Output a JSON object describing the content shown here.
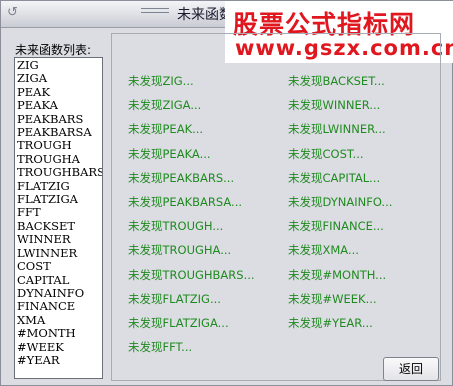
{
  "window": {
    "title": "未来函数",
    "watermark_line1": "股票公式指标网",
    "watermark_line2": "www.gszx.com.cn"
  },
  "list": {
    "label": "未来函数列表:",
    "items": [
      "ZIG",
      "ZIGA",
      "PEAK",
      "PEAKA",
      "PEAKBARS",
      "PEAKBARSA",
      "TROUGH",
      "TROUGHA",
      "TROUGHBARS",
      "FLATZIG",
      "FLATZIGA",
      "FFT",
      "BACKSET",
      "WINNER",
      "LWINNER",
      "COST",
      "CAPITAL",
      "DYNAINFO",
      "FINANCE",
      "XMA",
      "#MONTH",
      "#WEEK",
      "#YEAR"
    ]
  },
  "results": {
    "left": [
      "未发现ZIG...",
      "未发现ZIGA...",
      "未发现PEAK...",
      "未发现PEAKA...",
      "未发现PEAKBARS...",
      "未发现PEAKBARSA...",
      "未发现TROUGH...",
      "未发现TROUGHA...",
      "未发现TROUGHBARS...",
      "未发现FLATZIG...",
      "未发现FLATZIGA...",
      "未发现FFT..."
    ],
    "right": [
      "未发现BACKSET...",
      "未发现WINNER...",
      "未发现LWINNER...",
      "未发现COST...",
      "未发现CAPITAL...",
      "未发现DYNAINFO...",
      "未发现FINANCE...",
      "未发现XMA...",
      "未发现#MONTH...",
      "未发现#WEEK...",
      "未发现#YEAR..."
    ]
  },
  "buttons": {
    "back": "返回"
  },
  "colors": {
    "result_text": "#1f8a1f",
    "watermark": "#e0171f"
  }
}
